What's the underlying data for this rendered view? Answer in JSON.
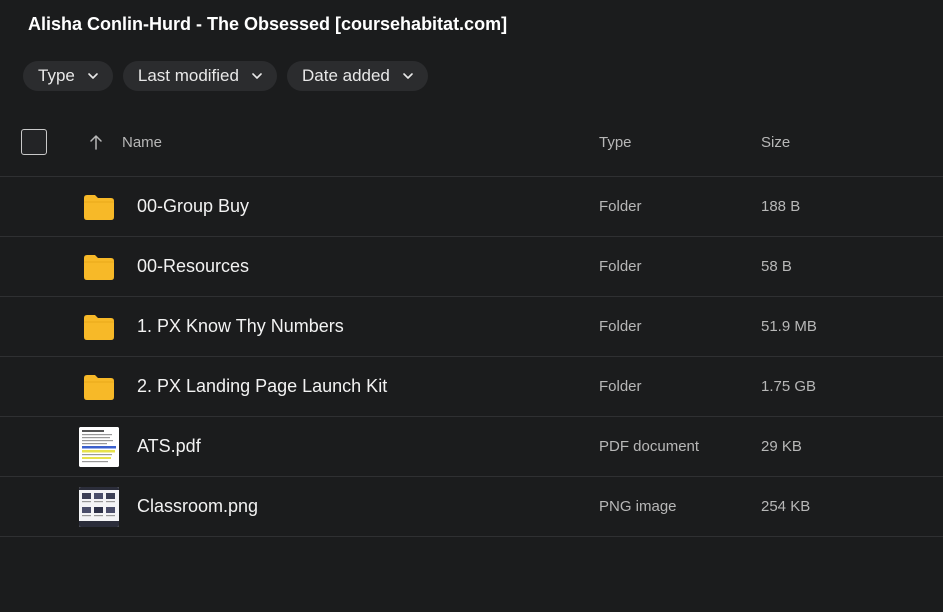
{
  "title": "Alisha Conlin-Hurd - The Obsessed [coursehabitat.com]",
  "filters": [
    {
      "label": "Type",
      "icon": "chevron-down-icon"
    },
    {
      "label": "Last modified",
      "icon": "chevron-down-icon"
    },
    {
      "label": "Date added",
      "icon": "chevron-down-icon"
    }
  ],
  "columns": {
    "name": "Name",
    "type": "Type",
    "size": "Size",
    "sort_icon": "arrow-up-icon"
  },
  "rows": [
    {
      "name": "00-Group Buy",
      "type": "Folder",
      "size": "188 B",
      "icon": "folder-icon"
    },
    {
      "name": "00-Resources",
      "type": "Folder",
      "size": "58 B",
      "icon": "folder-icon"
    },
    {
      "name": "1. PX Know Thy Numbers",
      "type": "Folder",
      "size": "51.9 MB",
      "icon": "folder-icon"
    },
    {
      "name": "2. PX Landing Page Launch Kit",
      "type": "Folder",
      "size": "1.75 GB",
      "icon": "folder-icon"
    },
    {
      "name": "ATS.pdf",
      "type": "PDF document",
      "size": "29 KB",
      "icon": "pdf-thumbnail"
    },
    {
      "name": "Classroom.png",
      "type": "PNG image",
      "size": "254 KB",
      "icon": "image-thumbnail"
    }
  ],
  "colors": {
    "background": "#1b1c1d",
    "chip": "#2b2c2e",
    "folder": "#f7b928",
    "divider": "#2f3032"
  }
}
